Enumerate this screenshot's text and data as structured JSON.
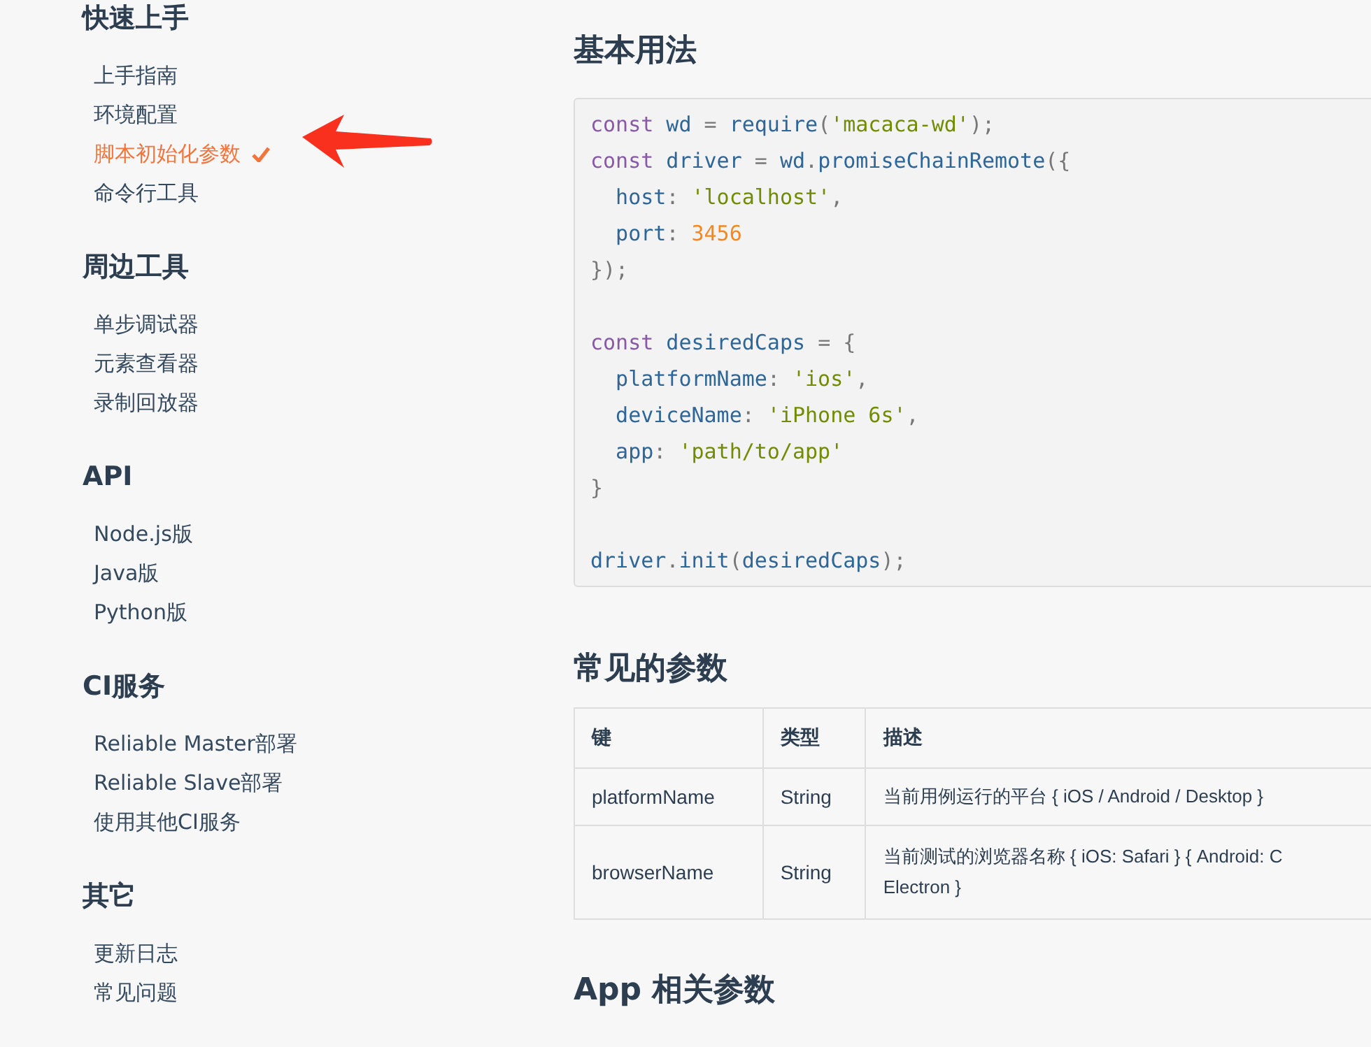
{
  "sidebar": {
    "sections": [
      {
        "title": "快速上手",
        "items": [
          {
            "label": "上手指南",
            "selected": false
          },
          {
            "label": "环境配置",
            "selected": false
          },
          {
            "label": "脚本初始化参数",
            "selected": true
          },
          {
            "label": "命令行工具",
            "selected": false
          }
        ]
      },
      {
        "title": "周边工具",
        "items": [
          {
            "label": "单步调试器",
            "selected": false
          },
          {
            "label": "元素查看器",
            "selected": false
          },
          {
            "label": "录制回放器",
            "selected": false
          }
        ]
      },
      {
        "title": "API",
        "items": [
          {
            "label": "Node.js版",
            "selected": false
          },
          {
            "label": "Java版",
            "selected": false
          },
          {
            "label": "Python版",
            "selected": false
          }
        ]
      },
      {
        "title": "CI服务",
        "items": [
          {
            "label": "Reliable Master部署",
            "selected": false
          },
          {
            "label": "Reliable Slave部署",
            "selected": false
          },
          {
            "label": "使用其他CI服务",
            "selected": false
          }
        ]
      },
      {
        "title": "其它",
        "items": [
          {
            "label": "更新日志",
            "selected": false
          },
          {
            "label": "常见问题",
            "selected": false
          }
        ]
      }
    ]
  },
  "content": {
    "heading": "基本用法",
    "code_blocks": [
      [
        [
          {
            "text": "const",
            "kind": "keyword"
          },
          {
            "text": " wd ",
            "kind": "name"
          },
          {
            "text": "=",
            "kind": "punct"
          },
          {
            "text": " require",
            "kind": "name"
          },
          {
            "text": "(",
            "kind": "punct"
          },
          {
            "text": "'macaca-wd'",
            "kind": "string"
          },
          {
            "text": ");",
            "kind": "punct"
          }
        ],
        [
          {
            "text": "const",
            "kind": "keyword"
          },
          {
            "text": " driver ",
            "kind": "name"
          },
          {
            "text": "=",
            "kind": "punct"
          },
          {
            "text": " wd",
            "kind": "name"
          },
          {
            "text": ".",
            "kind": "punct"
          },
          {
            "text": "promiseChainRemote",
            "kind": "name"
          },
          {
            "text": "({",
            "kind": "punct"
          }
        ],
        [
          {
            "text": "  host",
            "kind": "name"
          },
          {
            "text": ": ",
            "kind": "punct"
          },
          {
            "text": "'localhost'",
            "kind": "string"
          },
          {
            "text": ",",
            "kind": "punct"
          }
        ],
        [
          {
            "text": "  port",
            "kind": "name"
          },
          {
            "text": ": ",
            "kind": "punct"
          },
          {
            "text": "3456",
            "kind": "number"
          }
        ],
        [
          {
            "text": "});",
            "kind": "punct"
          }
        ]
      ],
      [
        [
          {
            "text": "const",
            "kind": "keyword"
          },
          {
            "text": " desiredCaps ",
            "kind": "name"
          },
          {
            "text": "= {",
            "kind": "punct"
          }
        ],
        [
          {
            "text": "  platformName",
            "kind": "name"
          },
          {
            "text": ": ",
            "kind": "punct"
          },
          {
            "text": "'ios'",
            "kind": "string"
          },
          {
            "text": ",",
            "kind": "punct"
          }
        ],
        [
          {
            "text": "  deviceName",
            "kind": "name"
          },
          {
            "text": ": ",
            "kind": "punct"
          },
          {
            "text": "'iPhone 6s'",
            "kind": "string"
          },
          {
            "text": ",",
            "kind": "punct"
          }
        ],
        [
          {
            "text": "  app",
            "kind": "name"
          },
          {
            "text": ": ",
            "kind": "punct"
          },
          {
            "text": "'path/to/app'",
            "kind": "string"
          }
        ],
        [
          {
            "text": "}",
            "kind": "punct"
          }
        ]
      ],
      [
        [
          {
            "text": "driver",
            "kind": "name"
          },
          {
            "text": ".",
            "kind": "punct"
          },
          {
            "text": "init",
            "kind": "name"
          },
          {
            "text": "(",
            "kind": "punct"
          },
          {
            "text": "desiredCaps",
            "kind": "name"
          },
          {
            "text": ");",
            "kind": "punct"
          }
        ]
      ]
    ],
    "params_heading": "常见的参数",
    "table": {
      "columns": [
        "键",
        "类型",
        "描述"
      ],
      "rows": [
        {
          "cells": [
            "platformName",
            "String"
          ],
          "description": [
            "当前用例运行的平台 { iOS / Android / Desktop }"
          ]
        },
        {
          "cells": [
            "browserName",
            "String"
          ],
          "description": [
            "当前测试的浏览器名称 { iOS: Safari } { Android: C",
            "Electron }"
          ]
        }
      ]
    },
    "next_heading": "App 相关参数"
  }
}
